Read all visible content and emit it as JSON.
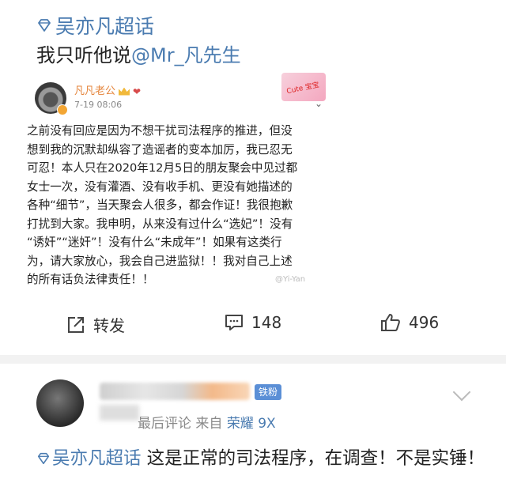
{
  "post": {
    "topic": "吴亦凡超话",
    "text_prefix": "我只听他说",
    "mention": "@Mr_凡先生"
  },
  "embedded": {
    "author": "凡凡老公",
    "time": "7-19 08:06",
    "sticker_text": "Cute 宝宝",
    "lines": [
      "之前没有回应是因为不想干扰司法程序的推进，但没",
      "想到我的沉默却纵容了造谣者的变本加厉，我已忍无",
      "可忍！本人只在2020年12月5日的朋友聚会中见过都",
      "女士一次，没有灌酒、没有收手机、更没有她描述的",
      "各种“细节”，当天聚会人很多，都会作证！我很抱歉",
      "打扰到大家。我申明，从来没有过什么“选妃”！没有",
      "“诱奸”“迷奸”！没有什么“未成年”！如果有这类行",
      "为，请大家放心，我会自己进监狱！！我对自己上述",
      "的所有话负法律责任！！"
    ],
    "watermark": "@Yi-Yan"
  },
  "actions": {
    "repost_label": "转发",
    "comments_count": "148",
    "likes_count": "496"
  },
  "comment": {
    "badge": "铁粉",
    "meta_prefix": "最后评论  来自 ",
    "device": "荣耀 9X",
    "topic": "吴亦凡超话",
    "text": " 这是正常的司法程序，在调查！不是实锤！"
  }
}
